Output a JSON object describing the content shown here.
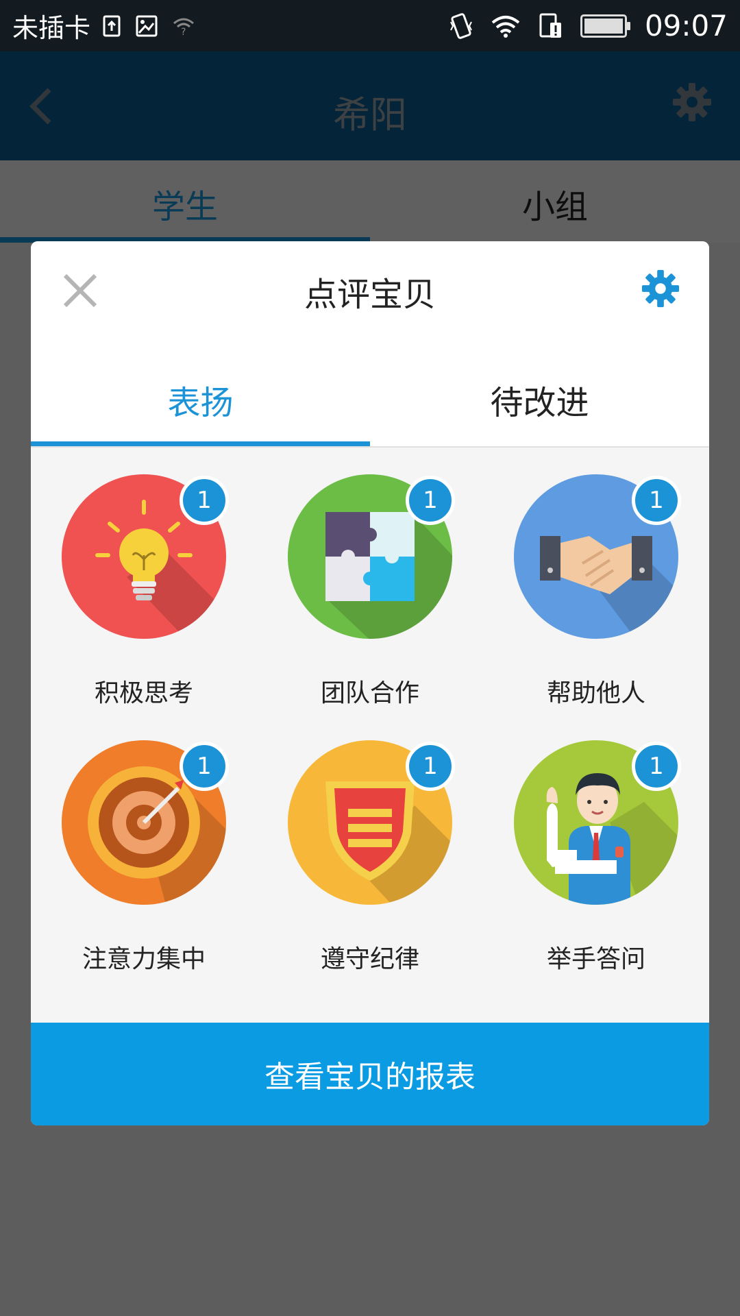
{
  "status_bar": {
    "carrier": "未插卡",
    "time": "09:07",
    "icons": [
      "sim-upload-icon",
      "image-icon",
      "wifi-question-icon",
      "vibrate-icon",
      "wifi-icon",
      "sim-alert-icon",
      "battery-icon"
    ]
  },
  "app_bar": {
    "title": "希阳",
    "back_icon": "chevron-left-icon",
    "settings_icon": "gear-icon"
  },
  "page_tabs": [
    {
      "label": "学生",
      "selected": true
    },
    {
      "label": "小组",
      "selected": false
    }
  ],
  "dialog": {
    "title": "点评宝贝",
    "close_icon": "close-icon",
    "settings_icon": "gear-icon",
    "tabs": [
      {
        "label": "表扬",
        "selected": true
      },
      {
        "label": "待改进",
        "selected": false
      }
    ],
    "items": [
      {
        "label": "积极思考",
        "badge": "1",
        "icon": "lightbulb-icon",
        "color": "#f05252"
      },
      {
        "label": "团队合作",
        "badge": "1",
        "icon": "puzzle-icon",
        "color": "#6cbd45"
      },
      {
        "label": "帮助他人",
        "badge": "1",
        "icon": "handshake-icon",
        "color": "#5e9be0"
      },
      {
        "label": "注意力集中",
        "badge": "1",
        "icon": "target-icon",
        "color": "#ef7d2a"
      },
      {
        "label": "遵守纪律",
        "badge": "1",
        "icon": "shield-icon",
        "color": "#f7b83a"
      },
      {
        "label": "举手答问",
        "badge": "1",
        "icon": "raise-hand-icon",
        "color": "#a6c93c"
      }
    ],
    "footer_button": "查看宝贝的报表"
  },
  "colors": {
    "accent": "#1b93d6",
    "footer": "#0b9be3",
    "app_bar": "#0b5b8f"
  }
}
